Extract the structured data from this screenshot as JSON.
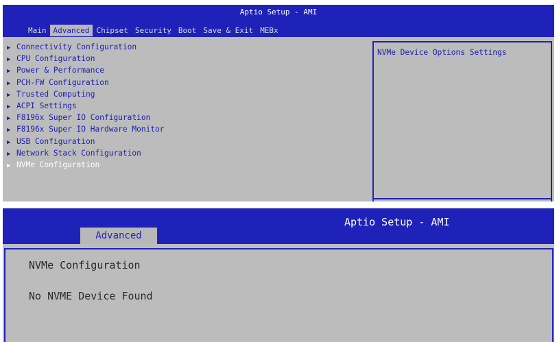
{
  "panel1": {
    "title": "Aptio Setup - AMI",
    "tabs": [
      {
        "label": "Main",
        "active": false
      },
      {
        "label": "Advanced",
        "active": true
      },
      {
        "label": "Chipset",
        "active": false
      },
      {
        "label": "Security",
        "active": false
      },
      {
        "label": "Boot",
        "active": false
      },
      {
        "label": "Save & Exit",
        "active": false
      },
      {
        "label": "MEBx",
        "active": false
      }
    ],
    "menu_items": [
      {
        "label": "Connectivity Configuration",
        "selected": false
      },
      {
        "label": "CPU Configuration",
        "selected": false
      },
      {
        "label": "Power & Performance",
        "selected": false
      },
      {
        "label": "PCH-FW Configuration",
        "selected": false
      },
      {
        "label": "Trusted Computing",
        "selected": false
      },
      {
        "label": "ACPI Settings",
        "selected": false
      },
      {
        "label": "F8196x Super IO Configuration",
        "selected": false
      },
      {
        "label": "F8196x Super IO Hardware Monitor",
        "selected": false
      },
      {
        "label": "USB Configuration",
        "selected": false
      },
      {
        "label": "Network Stack Configuration",
        "selected": false
      },
      {
        "label": "NVMe Configuration",
        "selected": true
      }
    ],
    "arrow_glyph": "▶",
    "help_text": "NVMe Device Options Settings"
  },
  "panel2": {
    "title": "Aptio Setup - AMI",
    "tab_label": "Advanced",
    "heading": "NVMe Configuration",
    "message": "No NVME Device Found"
  },
  "colors": {
    "header_blue": "#1f22b8",
    "body_gray": "#bcbcbc",
    "menu_text_blue": "#1a1fb0",
    "selected_text": "#ffffff"
  },
  "icons": {
    "submenu_arrow": "right-triangle-icon"
  }
}
